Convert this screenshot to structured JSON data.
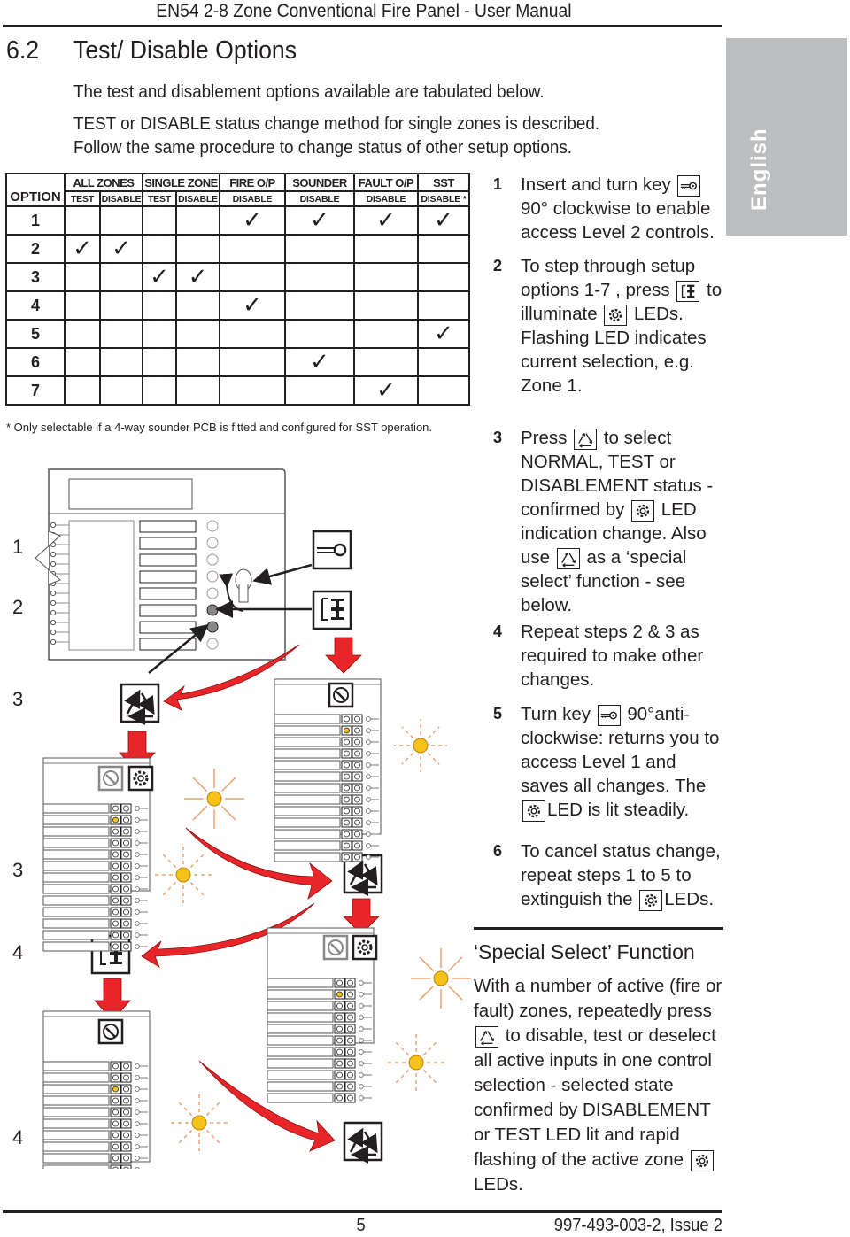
{
  "header": {
    "title": "EN54 2-8 Zone Conventional Fire Panel - User Manual"
  },
  "section": {
    "number": "6.2",
    "title": "Test/ Disable Options"
  },
  "intro": [
    "The test and disablement options available are tabulated below.",
    "TEST or DISABLE status change method for single zones is described.",
    "Follow the same procedure to change status of other setup options."
  ],
  "language_tab": "English",
  "table": {
    "option_header": "OPTION",
    "groups": [
      {
        "label": "ALL ZONES",
        "subs": [
          "TEST",
          "DISABLE"
        ]
      },
      {
        "label": "SINGLE ZONE",
        "subs": [
          "TEST",
          "DISABLE"
        ]
      },
      {
        "label": "FIRE O/P",
        "subs": [
          "DISABLE"
        ]
      },
      {
        "label": "SOUNDER",
        "subs": [
          "DISABLE"
        ]
      },
      {
        "label": "FAULT O/P",
        "subs": [
          "DISABLE"
        ]
      },
      {
        "label": "SST",
        "subs": [
          "DISABLE *"
        ]
      }
    ],
    "check_mark": "✓",
    "rows": [
      {
        "option": "1",
        "checks": [
          false,
          false,
          false,
          false,
          true,
          true,
          true,
          true
        ]
      },
      {
        "option": "2",
        "checks": [
          true,
          true,
          false,
          false,
          false,
          false,
          false,
          false
        ]
      },
      {
        "option": "3",
        "checks": [
          false,
          false,
          true,
          true,
          false,
          false,
          false,
          false
        ]
      },
      {
        "option": "4",
        "checks": [
          false,
          false,
          false,
          false,
          true,
          false,
          false,
          false
        ]
      },
      {
        "option": "5",
        "checks": [
          false,
          false,
          false,
          false,
          false,
          false,
          false,
          true
        ]
      },
      {
        "option": "6",
        "checks": [
          false,
          false,
          false,
          false,
          false,
          true,
          false,
          false
        ]
      },
      {
        "option": "7",
        "checks": [
          false,
          false,
          false,
          false,
          false,
          false,
          true,
          false
        ]
      }
    ],
    "footnote": "* Only selectable if a 4-way sounder PCB is fitted and configured for SST operation."
  },
  "steps": [
    {
      "n": "1",
      "parts": [
        "Insert and turn key ",
        "[key-icon]",
        " 90° clockwise to enable access Level 2 controls."
      ]
    },
    {
      "n": "2",
      "parts": [
        "To step through setup options 1-7 , press ",
        "[step-icon]",
        " to illuminate ",
        "[gear-icon]",
        " LEDs. Flashing LED indicates current selection, e.g. Zone 1."
      ]
    },
    {
      "n": "3",
      "parts": [
        "Press ",
        "[cycle-icon]",
        " to select NORMAL, TEST or DISABLEMENT status - confirmed by ",
        "[gear-icon]",
        " LED indication change. Also use ",
        "[cycle-icon]",
        " as a ‘special select’ function - see below."
      ]
    },
    {
      "n": "4",
      "parts": [
        "Repeat steps 2 & 3 as required to make other changes."
      ]
    },
    {
      "n": "5",
      "parts": [
        "Turn key ",
        "[key-icon]",
        " 90°anti-clockwise: returns you to access Level 1 and saves all changes. The ",
        "[gear-icon]",
        "LED is lit steadily."
      ]
    },
    {
      "n": "6",
      "parts": [
        "To cancel status change, repeat steps 1 to 5 to extinguish the ",
        "[gear-icon]",
        "LEDs."
      ]
    }
  ],
  "special_select": {
    "title": "‘Special Select’ Function",
    "parts": [
      "With a number of active (fire or fault) zones, repeatedly press ",
      "[cycle-icon]",
      " to disable, test or deselect all active inputs in one control selection - selected state confirmed by DISABLEMENT or TEST LED lit and rapid flashing of the active zone ",
      "[gear-icon]",
      " LEDs."
    ]
  },
  "diagram_labels": [
    "1",
    "2",
    "3",
    "3",
    "4",
    "4"
  ],
  "footer": {
    "page": "5",
    "doc_ref": "997-493-003-2, Issue 2"
  },
  "colors": {
    "text": "#231f20",
    "tab_gray": "#bcbdbf",
    "arrow_red": "#e8262a",
    "led_yellow": "#f7c21a",
    "ray_orange": "#f0a070",
    "led_gray": "#888888"
  }
}
